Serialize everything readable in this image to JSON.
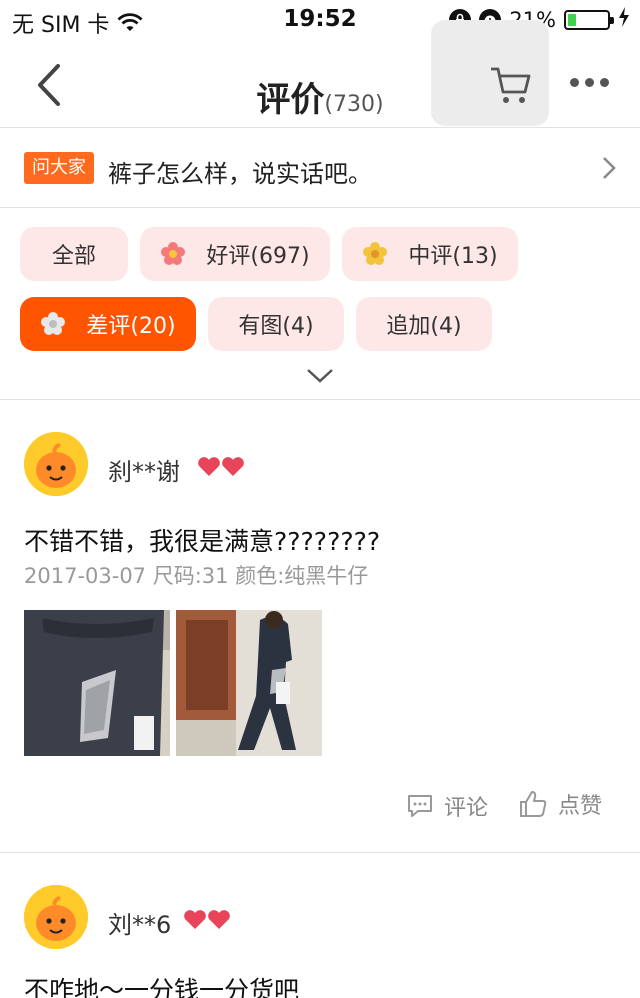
{
  "status_bar": {
    "carrier": "无 SIM 卡",
    "time": "19:52",
    "battery_percent": "21%",
    "battery_level": 0.21
  },
  "nav": {
    "title": "评价",
    "count": "(730)",
    "icons": [
      "back-icon",
      "cart-icon",
      "more-icon"
    ]
  },
  "ask": {
    "badge": "问大家",
    "question": "裤子怎么样，说实话吧。"
  },
  "filters": [
    {
      "label": "全部",
      "icon": ""
    },
    {
      "label": "好评(697)",
      "icon": "flower-red-icon"
    },
    {
      "label": "中评(13)",
      "icon": "flower-yellow-icon"
    },
    {
      "label": "差评(20)",
      "icon": "flower-grey-icon",
      "active": true
    },
    {
      "label": "有图(4)",
      "icon": ""
    },
    {
      "label": "追加(4)",
      "icon": ""
    }
  ],
  "reviews": [
    {
      "user": "刹**谢",
      "text": "不错不错，我很是满意????????",
      "meta": "2017-03-07 尺码:31  颜色:纯黑牛仔",
      "comment_label": "评论",
      "like_label": "点赞"
    },
    {
      "user": "刘**6",
      "text": "不咋地～一分钱一分货吧"
    }
  ],
  "colors": {
    "accent": "#ff5500",
    "chip_bg": "#fde8e7",
    "badge": "#ff6a1e"
  }
}
